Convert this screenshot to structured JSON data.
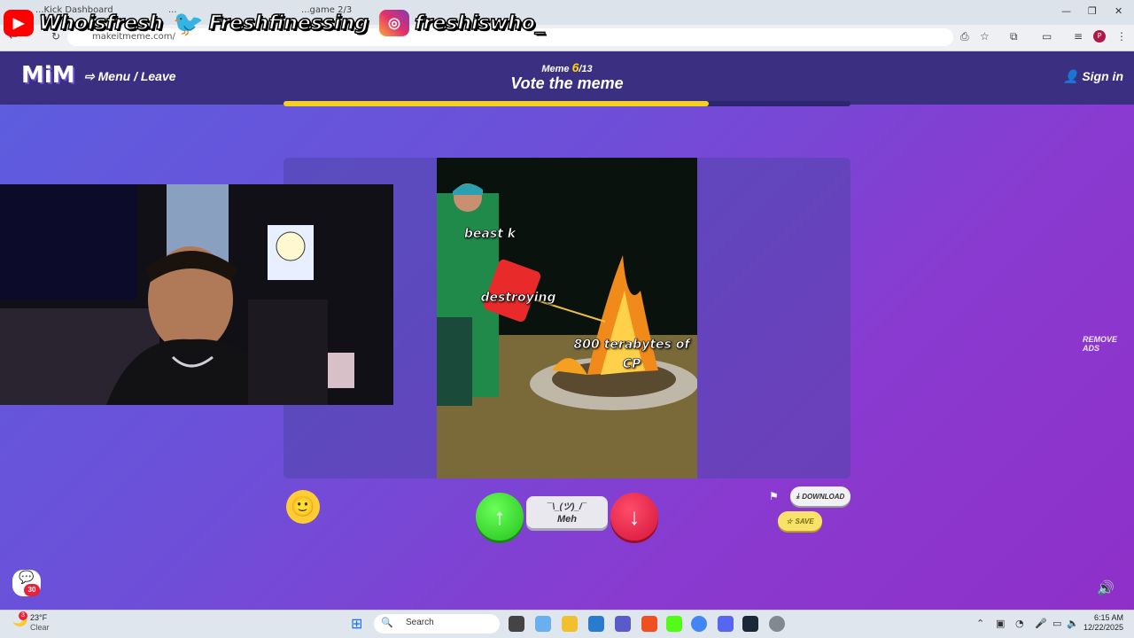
{
  "browser": {
    "tabs": [
      {
        "label": "...Kick Dashboard"
      },
      {
        "label": "..."
      },
      {
        "label": "...game 2/3"
      }
    ],
    "url": "makeitmeme.com/",
    "profile_initial": "P",
    "window_controls": {
      "minimize": "—",
      "maximize": "❐",
      "close": "✕"
    }
  },
  "overlay": {
    "youtube": "Whoisfresh",
    "twitter": "Freshfinessing",
    "instagram": "freshiswho_"
  },
  "header": {
    "logo": "MiM",
    "menu_label": "Menu / Leave",
    "meme_prefix": "Meme",
    "meme_current": "6",
    "meme_total": "/13",
    "title": "Vote the meme",
    "sign_in": "Sign in",
    "progress": 0.75
  },
  "meme": {
    "captions": {
      "top": "beast k",
      "middle": "destroying",
      "bottom": "800 terabytes of CP"
    }
  },
  "vote": {
    "up_icon": "arrow-up",
    "down_icon": "arrow-down",
    "meh_face": "¯\\_(ツ)_/¯",
    "meh_label": "Meh"
  },
  "actions": {
    "download": "DOWNLOAD",
    "save": "SAVE",
    "remove_ads": "REMOVE ADS"
  },
  "chat": {
    "badge": "30"
  },
  "taskbar": {
    "search_placeholder": "Search",
    "weather_temp": "23°F",
    "weather_desc": "Clear",
    "weather_badge": "3",
    "time": "6:15 AM",
    "date": "12/22/2025"
  },
  "colors": {
    "accent_yellow": "#f5d020",
    "upvote_green": "#22c21a",
    "downvote_red": "#d4143a",
    "topbar": "#3a2f80"
  }
}
